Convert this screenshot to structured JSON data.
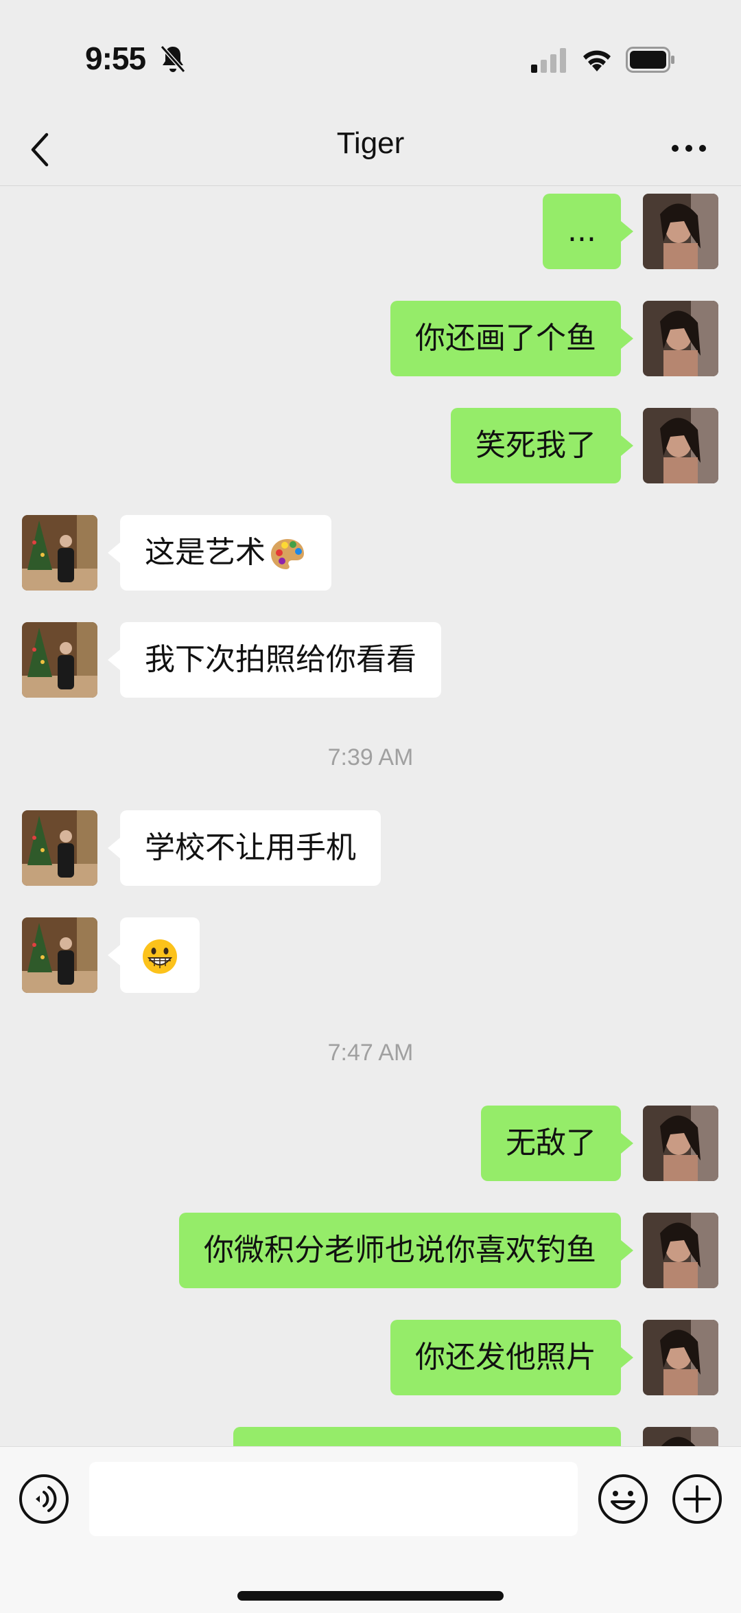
{
  "status_bar": {
    "time": "9:55"
  },
  "nav": {
    "title": "Tiger"
  },
  "messages": [
    {
      "side": "right",
      "text": "..."
    },
    {
      "side": "right",
      "text": "你还画了个鱼"
    },
    {
      "side": "right",
      "text": "笑死我了"
    },
    {
      "side": "left",
      "text": "这是艺术",
      "emoji": "palette"
    },
    {
      "side": "left",
      "text": "我下次拍照给你看看"
    },
    {
      "timestamp": "7:39 AM"
    },
    {
      "side": "left",
      "text": "学校不让用手机"
    },
    {
      "side": "left",
      "text": "",
      "emoji": "grinning-face"
    },
    {
      "timestamp": "7:47 AM"
    },
    {
      "side": "right",
      "text": "无敌了"
    },
    {
      "side": "right",
      "text": "你微积分老师也说你喜欢钓鱼"
    },
    {
      "side": "right",
      "text": "你还发他照片"
    },
    {
      "side": "right",
      "text": ""
    }
  ],
  "input_bar": {
    "text_value": ""
  },
  "colors": {
    "background": "#ededed",
    "sent_bubble": "#95ec69",
    "received_bubble": "#ffffff"
  }
}
